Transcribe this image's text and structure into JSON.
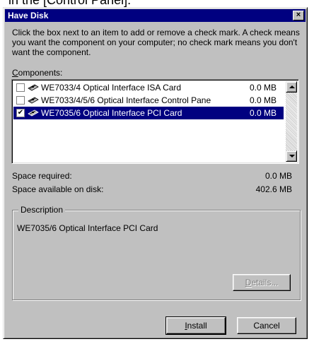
{
  "top_caption": "in the [Control Panel].",
  "window": {
    "title": "Have Disk",
    "close_glyph": "×"
  },
  "instructions": "Click the box next to an item to add or remove a check mark. A check means you want the component  on your computer; no check mark means you don't want the component.",
  "components_label": {
    "mnemonic": "C",
    "rest": "omponents:"
  },
  "components": [
    {
      "name": "WE7033/4 Optical Interface ISA Card",
      "size": "0.0 MB",
      "checked": false,
      "selected": false,
      "icon": "network-card-icon"
    },
    {
      "name": "WE7033/4/5/6 Optical Interface Control Pane",
      "size": "0.0 MB",
      "checked": false,
      "selected": false,
      "icon": "network-card-icon"
    },
    {
      "name": "WE7035/6 Optical Interface PCI Card",
      "size": "0.0 MB",
      "checked": true,
      "selected": true,
      "icon": "network-card-icon"
    }
  ],
  "space_required": {
    "label": "Space required:",
    "value": "0.0 MB"
  },
  "space_available": {
    "label": "Space available on disk:",
    "value": "402.6 MB"
  },
  "description": {
    "legend": "Description",
    "text": "WE7035/6 Optical Interface PCI Card"
  },
  "buttons": {
    "details": {
      "mnemonic": "D",
      "rest": "etails...",
      "enabled": false
    },
    "install": {
      "mnemonic": "I",
      "rest": "nstall"
    },
    "cancel": "Cancel"
  },
  "check_glyph": "✔"
}
